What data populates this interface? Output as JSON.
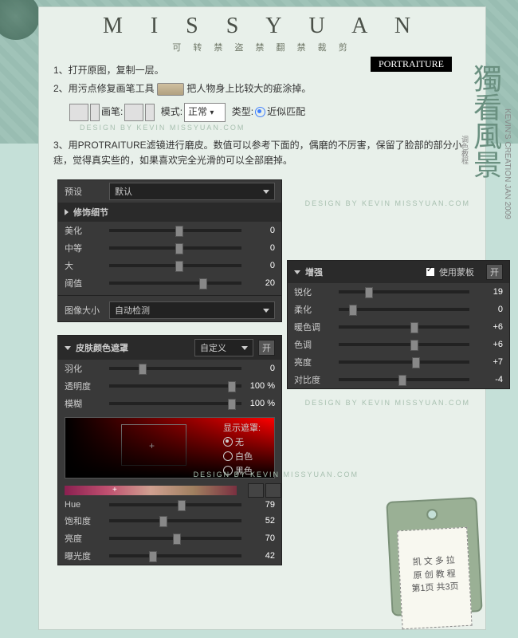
{
  "header": {
    "title": "M I S S Y U A N",
    "subtitle": "可 转 禁 盗 禁 翻 禁 裁 剪",
    "badge": "PORTRAITURE"
  },
  "instructions": {
    "step1": "1、打开原图，复制一层。",
    "step2a": "2、用污点修复画笔工具",
    "step2b": "把人物身上比较大的疵涂掉。",
    "step3": "3、用PROTRAITURE滤镜进行磨皮。数值可以参考下面的，偶磨的不厉害，保留了脸部的部分小痣，觉得真实些的，如果喜欢完全光滑的可以全部磨掉。"
  },
  "toolbar": {
    "brush_label": "画笔:",
    "mode_label": "模式:",
    "mode_value": "正常",
    "type_label": "类型:",
    "type_value": "近似匹配"
  },
  "panel1": {
    "preset_label": "预设",
    "preset_value": "默认",
    "section": "修饰细节",
    "sliders": [
      {
        "label": "美化",
        "value": "0",
        "pos": 50
      },
      {
        "label": "中等",
        "value": "0",
        "pos": 50
      },
      {
        "label": "大",
        "value": "0",
        "pos": 50
      },
      {
        "label": "阈值",
        "value": "20",
        "pos": 68
      }
    ],
    "size_label": "图像大小",
    "size_value": "自动检测"
  },
  "panel2": {
    "title": "皮肤颜色遮罩",
    "mode": "自定义",
    "open_btn": "开",
    "sliders1": [
      {
        "label": "羽化",
        "value": "0",
        "pos": 22
      },
      {
        "label": "透明度",
        "value": "100 %",
        "pos": 90
      },
      {
        "label": "模糊",
        "value": "100 %",
        "pos": 90
      }
    ],
    "mask_label": "显示遮罩:",
    "mask_opts": [
      "无",
      "白色",
      "黑色"
    ],
    "sliders2": [
      {
        "label": "Hue",
        "value": "79",
        "pos": 52
      },
      {
        "label": "饱和度",
        "value": "52",
        "pos": 38
      },
      {
        "label": "亮度",
        "value": "70",
        "pos": 48
      },
      {
        "label": "曝光度",
        "value": "42",
        "pos": 30
      }
    ]
  },
  "panel3": {
    "title": "增强",
    "use_mask": "使用蒙板",
    "open_btn": "开",
    "sliders": [
      {
        "label": "锐化",
        "value": "19",
        "pos": 20
      },
      {
        "label": "柔化",
        "value": "0",
        "pos": 8
      },
      {
        "label": "暖色调",
        "value": "+6",
        "pos": 55
      },
      {
        "label": "色调",
        "value": "+6",
        "pos": 55
      },
      {
        "label": "亮度",
        "value": "+7",
        "pos": 56
      },
      {
        "label": "对比度",
        "value": "-4",
        "pos": 46
      }
    ]
  },
  "side": {
    "big": "獨看風景",
    "small": "调色教程",
    "credit": "KEVIN'S CREATION JAN 2009"
  },
  "tag": {
    "line1": "凯 文 多 拉",
    "line2": "原 创 教 程",
    "line3": "第1页 共3页"
  },
  "wm": "DESIGN BY KEVIN MISSYUAN.COM"
}
